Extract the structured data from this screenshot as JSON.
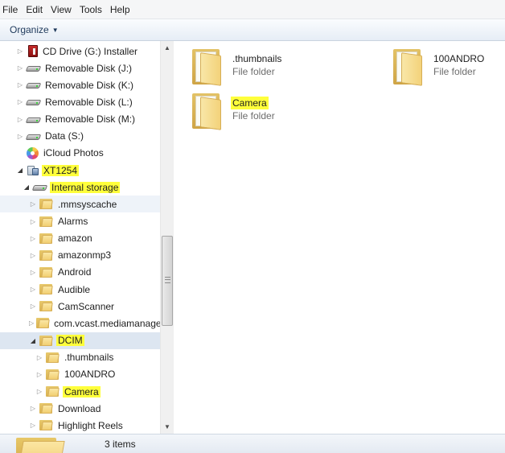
{
  "menu": [
    "File",
    "Edit",
    "View",
    "Tools",
    "Help"
  ],
  "toolbar": {
    "organize_label": "Organize",
    "organize_caret": "▼"
  },
  "scrollbar": {
    "up": "▲",
    "down": "▼"
  },
  "nav_tree": [
    {
      "label": "CD Drive (G:) Installer",
      "icon": "cd-drive-icon",
      "level": 1,
      "twisty": "collapsed",
      "highlight": false,
      "state": ""
    },
    {
      "label": "Removable Disk (J:)",
      "icon": "drive-icon",
      "level": 1,
      "twisty": "collapsed",
      "highlight": false,
      "state": ""
    },
    {
      "label": "Removable Disk (K:)",
      "icon": "drive-icon",
      "level": 1,
      "twisty": "collapsed",
      "highlight": false,
      "state": ""
    },
    {
      "label": "Removable Disk (L:)",
      "icon": "drive-icon",
      "level": 1,
      "twisty": "collapsed",
      "highlight": false,
      "state": ""
    },
    {
      "label": "Removable Disk (M:)",
      "icon": "drive-icon",
      "level": 1,
      "twisty": "collapsed",
      "highlight": false,
      "state": ""
    },
    {
      "label": "Data (S:)",
      "icon": "drive-icon",
      "level": 1,
      "twisty": "collapsed",
      "highlight": false,
      "state": ""
    },
    {
      "label": "iCloud Photos",
      "icon": "photos-icon",
      "level": 1,
      "twisty": "none",
      "highlight": false,
      "state": ""
    },
    {
      "label": "XT1254",
      "icon": "portable-device-icon",
      "level": 1,
      "twisty": "expanded",
      "highlight": true,
      "state": ""
    },
    {
      "label": "Internal storage",
      "icon": "drive-icon",
      "level": 2,
      "twisty": "expanded",
      "highlight": true,
      "state": ""
    },
    {
      "label": ".mmsyscache",
      "icon": "folder-icon",
      "level": 3,
      "twisty": "collapsed",
      "highlight": false,
      "state": "hover"
    },
    {
      "label": "Alarms",
      "icon": "folder-icon",
      "level": 3,
      "twisty": "collapsed",
      "highlight": false,
      "state": ""
    },
    {
      "label": "amazon",
      "icon": "folder-icon",
      "level": 3,
      "twisty": "collapsed",
      "highlight": false,
      "state": ""
    },
    {
      "label": "amazonmp3",
      "icon": "folder-icon",
      "level": 3,
      "twisty": "collapsed",
      "highlight": false,
      "state": ""
    },
    {
      "label": "Android",
      "icon": "folder-icon",
      "level": 3,
      "twisty": "collapsed",
      "highlight": false,
      "state": ""
    },
    {
      "label": "Audible",
      "icon": "folder-icon",
      "level": 3,
      "twisty": "collapsed",
      "highlight": false,
      "state": ""
    },
    {
      "label": "CamScanner",
      "icon": "folder-icon",
      "level": 3,
      "twisty": "collapsed",
      "highlight": false,
      "state": ""
    },
    {
      "label": "com.vcast.mediamanager",
      "icon": "folder-icon",
      "level": 3,
      "twisty": "collapsed",
      "highlight": false,
      "state": ""
    },
    {
      "label": "DCIM",
      "icon": "folder-icon",
      "level": 3,
      "twisty": "expanded",
      "highlight": true,
      "state": "selected"
    },
    {
      "label": ".thumbnails",
      "icon": "folder-icon",
      "level": 4,
      "twisty": "collapsed",
      "highlight": false,
      "state": ""
    },
    {
      "label": "100ANDRO",
      "icon": "folder-icon",
      "level": 4,
      "twisty": "collapsed",
      "highlight": false,
      "state": ""
    },
    {
      "label": "Camera",
      "icon": "folder-icon",
      "level": 4,
      "twisty": "collapsed",
      "highlight": true,
      "state": ""
    },
    {
      "label": "Download",
      "icon": "folder-icon",
      "level": 3,
      "twisty": "collapsed",
      "highlight": false,
      "state": ""
    },
    {
      "label": "Highlight Reels",
      "icon": "folder-icon",
      "level": 3,
      "twisty": "collapsed",
      "highlight": false,
      "state": ""
    }
  ],
  "content_items": [
    {
      "name": ".thumbnails",
      "type": "File folder",
      "highlight": false
    },
    {
      "name": "100ANDRO",
      "type": "File folder",
      "highlight": false
    },
    {
      "name": "Camera",
      "type": "File folder",
      "highlight": true
    }
  ],
  "status": {
    "item_count": "3 items"
  },
  "colors": {
    "highlight": "#ffff3b",
    "selection": "#dde6f1",
    "toolbar_text": "#1e395b"
  }
}
